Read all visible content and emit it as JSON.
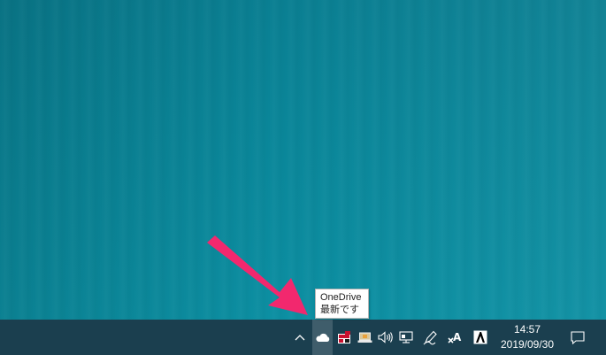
{
  "tooltip": {
    "title": "OneDrive",
    "status": "最新です"
  },
  "tray": {
    "icons": [
      "chevron-up-icon",
      "onedrive-cloud-icon",
      "red-app-icon",
      "laptop-app-icon",
      "volume-icon",
      "network-icon",
      "pen-icon",
      "ime-icon",
      "font-a-icon",
      "notification-icon"
    ],
    "clock": {
      "time": "14:57",
      "date": "2019/09/30"
    }
  },
  "colors": {
    "desktop": "#0a8699",
    "taskbar": "#1b3f4f",
    "arrow": "#f2286e"
  }
}
